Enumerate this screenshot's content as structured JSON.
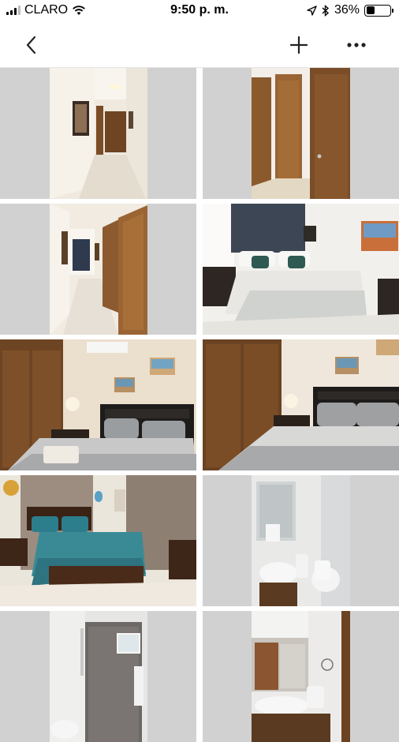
{
  "status_bar": {
    "carrier": "CLARO",
    "time": "9:50 p. m.",
    "battery": "36%",
    "battery_level": 0.36
  },
  "nav": {
    "back_icon": "chevron-left-icon",
    "add_icon": "plus-icon",
    "more_icon": "ellipsis-icon"
  },
  "photos": [
    {
      "subject": "hallway with framed pictures"
    },
    {
      "subject": "wooden doors"
    },
    {
      "subject": "hallway with wooden doors"
    },
    {
      "subject": "bedroom with dark curtains"
    },
    {
      "subject": "bedroom with wardrobe and lamp"
    },
    {
      "subject": "bedroom with wardrobe and grey bedding"
    },
    {
      "subject": "bedroom with teal quilt"
    },
    {
      "subject": "bathroom sink and toilet"
    },
    {
      "subject": "stone tile shower"
    },
    {
      "subject": "bathroom mirror and sink"
    }
  ],
  "colors": {
    "placeholder": "#d1d1d1",
    "wall": "#f1ede6",
    "wood": "#7a4a24",
    "floor": "#e4ddd1"
  }
}
